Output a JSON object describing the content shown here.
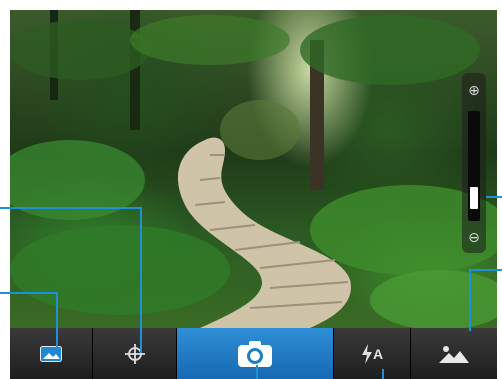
{
  "viewfinder": {
    "zoom": {
      "in_icon": "zoom-in-icon",
      "out_icon": "zoom-out-icon",
      "level": 0.35
    }
  },
  "toolbar": {
    "items": [
      {
        "name": "gallery",
        "icon": "gallery-thumbnail-icon"
      },
      {
        "name": "focus",
        "icon": "crosshair-icon"
      },
      {
        "name": "shutter",
        "icon": "camera-icon"
      },
      {
        "name": "flash",
        "icon": "flash-auto-icon",
        "label": "A"
      },
      {
        "name": "scene",
        "icon": "landscape-icon"
      }
    ]
  },
  "colors": {
    "accent": "#1f8fd6",
    "toolbar_bg": "#2a2a2a",
    "shutter_bg": "#1e7fc8"
  }
}
